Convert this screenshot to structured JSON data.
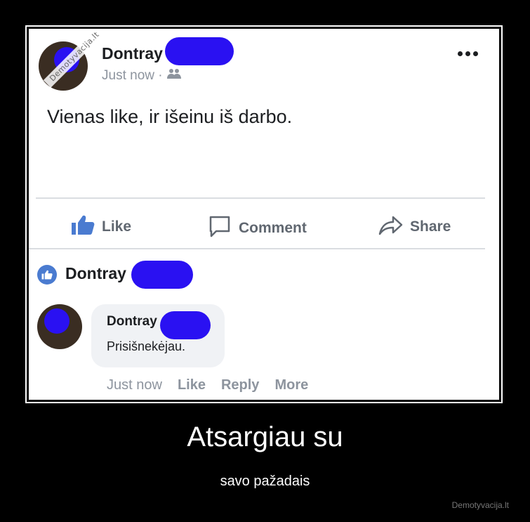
{
  "post": {
    "author": "Dontray",
    "timestamp": "Just now",
    "audience_icon": "friends-icon",
    "more_icon": "more-options-icon",
    "text": "Vienas like, ir išeinu iš darbo."
  },
  "actions": {
    "like_label": "Like",
    "comment_label": "Comment",
    "share_label": "Share"
  },
  "likes": {
    "name": "Dontray"
  },
  "comment": {
    "author": "Dontray",
    "text": "Prisišnekėjau.",
    "time": "Just now",
    "like_label": "Like",
    "reply_label": "Reply",
    "more_label": "More"
  },
  "watermark_text": "Demotyvacija.lt",
  "caption": {
    "title": "Atsargiau su",
    "subtitle": "savo pažadais"
  },
  "site_label": "Demotyvacija.lt",
  "colors": {
    "redaction": "#2a11f2",
    "facebook_blue": "#4267b2",
    "action_gray": "#606770"
  }
}
